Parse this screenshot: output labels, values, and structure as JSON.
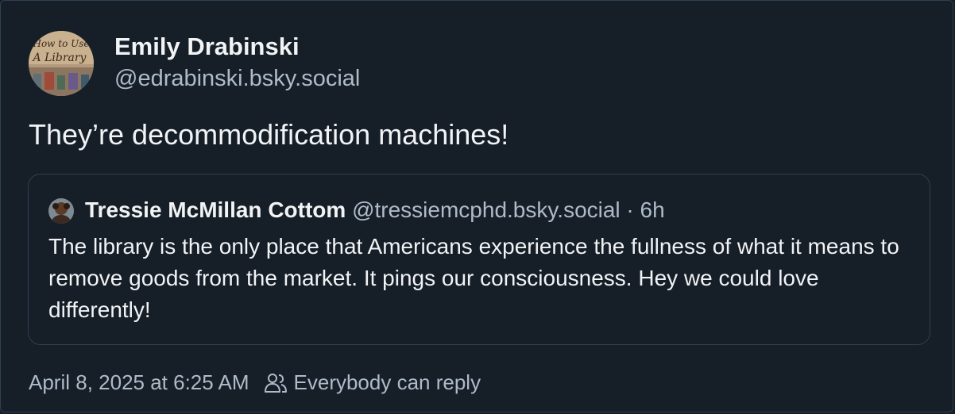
{
  "post": {
    "author": {
      "display_name": "Emily Drabinski",
      "handle": "@edrabinski.bsky.social",
      "avatar_icon": "library-book-cover-avatar",
      "avatar_text_line1": "How to Use",
      "avatar_text_line2": "A Library"
    },
    "text": "They’re decommodification machines!",
    "quote": {
      "author": {
        "display_name": "Tressie McMillan Cottom",
        "handle": "@tressiemcphd.bsky.social",
        "avatar_icon": "portrait-avatar"
      },
      "age_separator": " · ",
      "age": "6h",
      "text": "The library is the only place that Americans experience the fullness of what it means to remove goods from the market. It pings our consciousness. Hey we could love differently!"
    },
    "timestamp": "April 8, 2025 at 6:25 AM",
    "reply_setting": {
      "icon": "people-icon",
      "label": "Everybody can reply"
    }
  },
  "colors": {
    "background": "#161e27",
    "border": "#2e4052",
    "text_primary": "#f1f3f5",
    "text_secondary": "#aebbc9"
  }
}
